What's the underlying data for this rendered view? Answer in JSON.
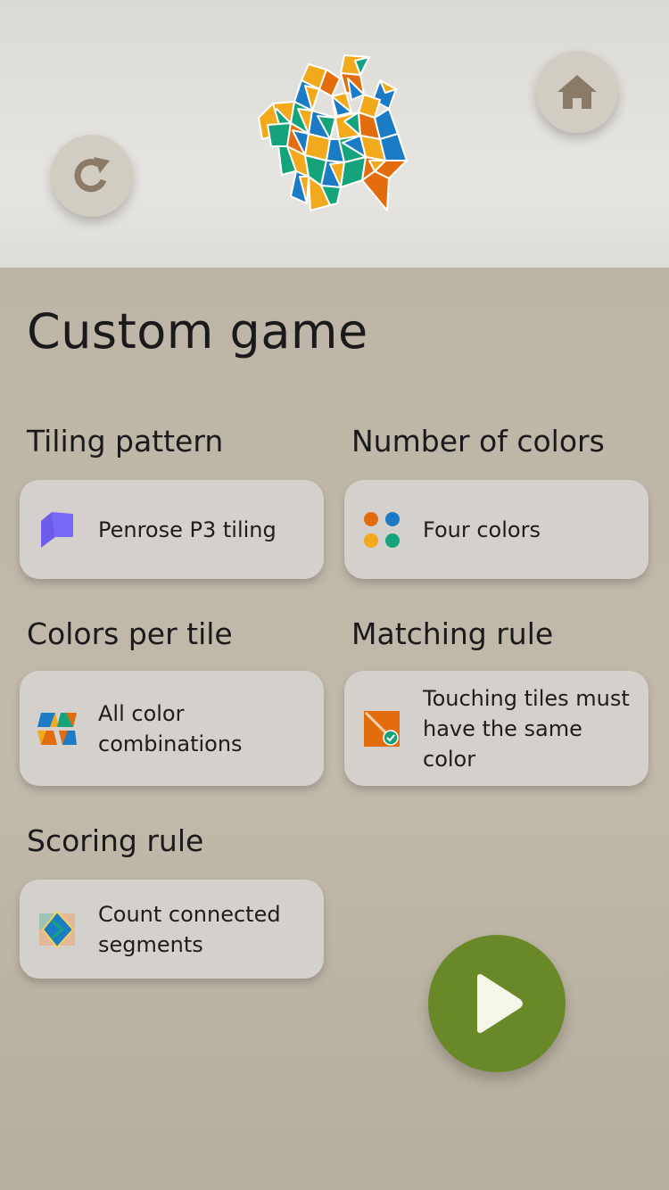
{
  "header": {
    "home_icon": "home-icon",
    "reset_icon": "refresh-icon",
    "logo": "penrose-tiling-logo"
  },
  "page": {
    "title": "Custom game"
  },
  "sections": {
    "tiling_pattern": {
      "label": "Tiling pattern",
      "value": "Penrose P3 tiling",
      "icon": "penrose-rhombus-icon"
    },
    "number_of_colors": {
      "label": "Number of colors",
      "value": "Four colors",
      "icon": "four-color-dots-icon"
    },
    "colors_per_tile": {
      "label": "Colors per tile",
      "value_line1": "All color",
      "value_line2": "combinations",
      "icon": "color-combinations-icon"
    },
    "matching_rule": {
      "label": "Matching rule",
      "value_line1": "Touching tiles must",
      "value_line2": "have the same",
      "value_line3": "color",
      "icon": "matching-rule-icon"
    },
    "scoring_rule": {
      "label": "Scoring rule",
      "value_line1": "Count connected",
      "value_line2": "segments",
      "icon": "connected-segments-icon"
    }
  },
  "play": {
    "icon": "play-icon"
  },
  "colors": {
    "accent_green": "#698928",
    "orange": "#e36d0c",
    "blue": "#1b7bc4",
    "yellow": "#f2a91b",
    "teal": "#15a37b",
    "purple": "#7669f5"
  }
}
